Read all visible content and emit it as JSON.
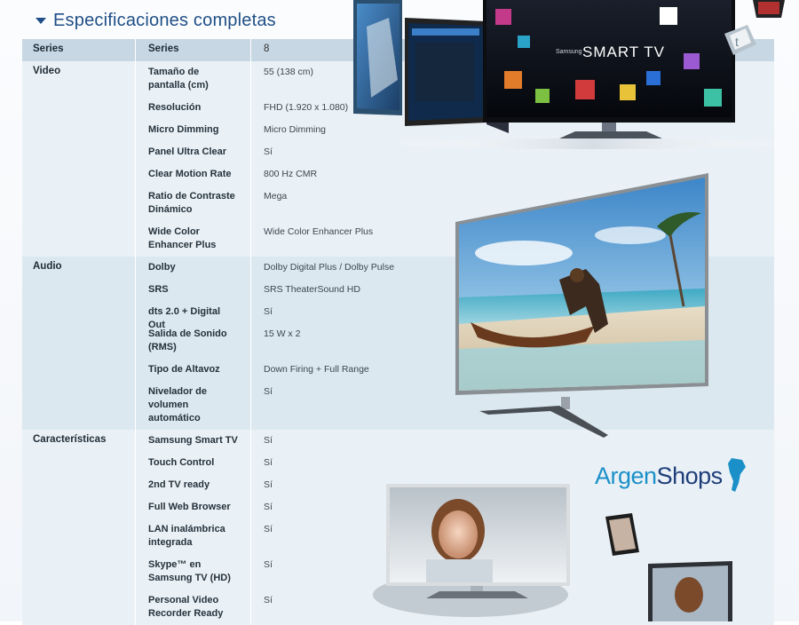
{
  "header": {
    "title": "Especificaciones completas"
  },
  "table": {
    "header_row": {
      "col1": "Series",
      "col2": "Series",
      "col3": "8"
    },
    "groups": [
      {
        "category": "Video",
        "items": [
          {
            "label": "Tamaño de pantalla (cm)",
            "value": "55 (138 cm)"
          },
          {
            "label": "Resolución",
            "value": "FHD (1.920 x 1.080)"
          },
          {
            "label": "Micro Dimming",
            "value": "Micro Dimming"
          },
          {
            "label": "Panel Ultra Clear",
            "value": "Sí"
          },
          {
            "label": "Clear Motion Rate",
            "value": "800 Hz CMR"
          },
          {
            "label": "Ratio de Contraste Dinámico",
            "value": "Mega"
          },
          {
            "label": "Wide Color Enhancer Plus",
            "value": "Wide Color Enhancer Plus"
          }
        ]
      },
      {
        "category": "Audio",
        "items": [
          {
            "label": "Dolby",
            "value": "Dolby Digital Plus / Dolby Pulse"
          },
          {
            "label": "SRS",
            "value": "SRS TheaterSound HD"
          },
          {
            "label": "dts 2.0 + Digital Out",
            "value": "Sí"
          },
          {
            "label": "Salida de Sonido (RMS)",
            "value": "15 W x 2"
          },
          {
            "label": "Tipo de Altavoz",
            "value": "Down Firing + Full Range"
          },
          {
            "label": "Nivelador de volumen automático",
            "value": "Sí"
          }
        ]
      },
      {
        "category": "Características",
        "items": [
          {
            "label": "Samsung Smart TV",
            "value": "Sí"
          },
          {
            "label": "Touch Control",
            "value": "Sí"
          },
          {
            "label": "2nd TV ready",
            "value": "Sí"
          },
          {
            "label": "Full Web Browser",
            "value": "Sí"
          },
          {
            "label": "LAN inalámbrica integrada",
            "value": "Sí"
          },
          {
            "label": "Skype™ en Samsung TV (HD)",
            "value": "Sí"
          },
          {
            "label": "Personal Video Recorder Ready",
            "value": "Sí"
          }
        ]
      }
    ]
  },
  "promo": {
    "smart_tv_brand": "Samsung",
    "smart_tv_logo": "SMART TV",
    "logo_part1": "Argen",
    "logo_part2": "Shops",
    "icons": [
      "twitter-cube-icon",
      "argentina-map-icon"
    ]
  },
  "colors": {
    "title": "#1f4f86",
    "header_row": "#c7d7e3",
    "group_light": "#eaf1f6",
    "group_dark": "#dbe8f0",
    "logo_blue": "#1b90c8",
    "logo_navy": "#1e3e7a"
  }
}
